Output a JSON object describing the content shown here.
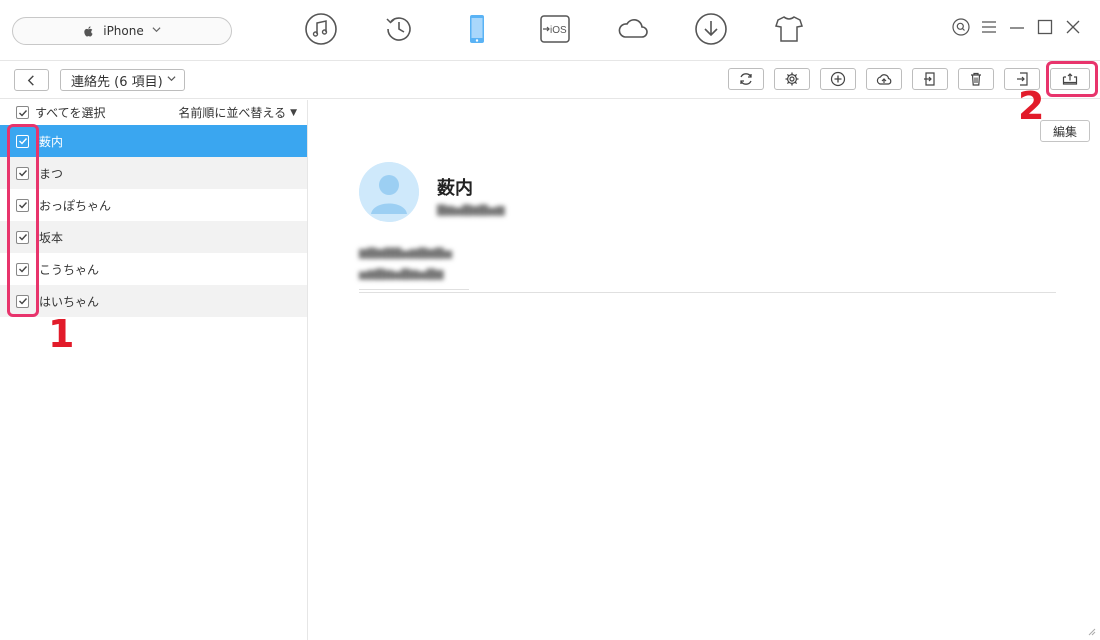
{
  "device": {
    "name": "iPhone"
  },
  "toolbar": {
    "category_label": "連絡先 (6 項目)"
  },
  "list": {
    "select_all_label": "すべてを選択",
    "sort_label": "名前順に並べ替える",
    "items": [
      {
        "name": "薮内",
        "selected": true,
        "checked": true
      },
      {
        "name": "まつ",
        "selected": false,
        "checked": true
      },
      {
        "name": "おっぽちゃん",
        "selected": false,
        "checked": true
      },
      {
        "name": "坂本",
        "selected": false,
        "checked": true
      },
      {
        "name": "こうちゃん",
        "selected": false,
        "checked": true
      },
      {
        "name": "はいちゃん",
        "selected": false,
        "checked": true
      }
    ]
  },
  "detail": {
    "edit_label": "編集",
    "contact_name": "薮内"
  },
  "annotations": {
    "step1": "1",
    "step2": "2"
  },
  "colors": {
    "accent": "#3aa6f0",
    "highlight": "#e8346c",
    "step_number": "#e21b2a"
  },
  "nav_icons": [
    "music-icon",
    "history-icon",
    "phone-icon",
    "ios-transfer-icon",
    "cloud-icon",
    "download-icon",
    "tshirt-icon"
  ],
  "tool_icons": [
    "refresh-icon",
    "settings-icon",
    "add-icon",
    "upload-cloud-icon",
    "export-icon",
    "trash-icon",
    "import-icon",
    "download-to-pc-icon"
  ]
}
